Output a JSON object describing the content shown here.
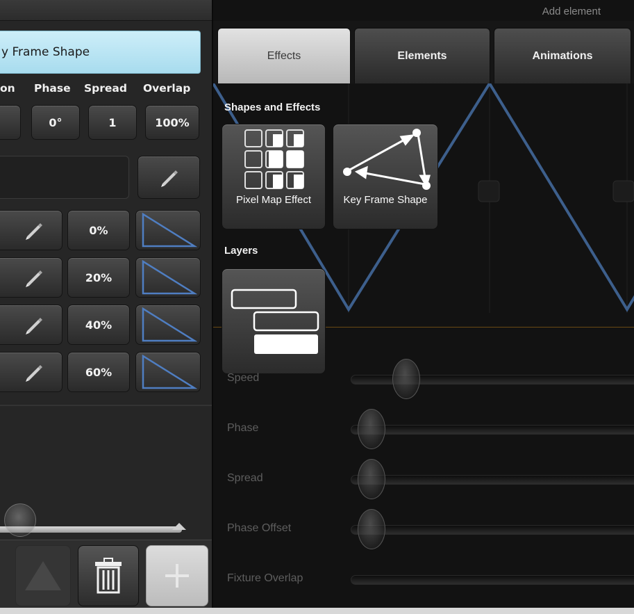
{
  "left_panel": {
    "title_field": "y Frame Shape",
    "param_labels": [
      "on",
      "Phase",
      "Spread",
      "Overlap"
    ],
    "param_values": [
      "0°",
      "1",
      "100%"
    ],
    "key_rows": [
      {
        "value": "0%"
      },
      {
        "value": "20%"
      },
      {
        "value": "40%"
      },
      {
        "value": "60%"
      }
    ]
  },
  "right_panel": {
    "header_label": "Add element",
    "tabs": [
      {
        "label": "Effects",
        "active": true
      },
      {
        "label": "Elements",
        "active": false
      },
      {
        "label": "Animations",
        "active": false
      }
    ],
    "popup": {
      "section_shapes": "Shapes and Effects",
      "tile_pixel_map": "Pixel Map Effect",
      "tile_key_frame": "Key Frame Shape",
      "section_layers": "Layers"
    },
    "sliders": [
      {
        "label": "Speed",
        "value": 0.17
      },
      {
        "label": "Phase",
        "value": 0
      },
      {
        "label": "Spread",
        "value": 0
      },
      {
        "label": "Phase Offset",
        "value": 0
      },
      {
        "label": "Fixture Overlap",
        "value": 0
      }
    ]
  },
  "colors": {
    "title_field_bg": "#b9e4f4",
    "active_tab_bg": "#cfcfcf",
    "waveform_line": "#3d5f8c",
    "triangle_line": "#4f7ec2"
  },
  "icons": [
    "pencil-icon",
    "triangle-ramp-icon",
    "up-arrow-icon",
    "trash-icon",
    "plus-icon",
    "pixel-grid-icon",
    "keyframe-path-icon",
    "layers-icon"
  ]
}
